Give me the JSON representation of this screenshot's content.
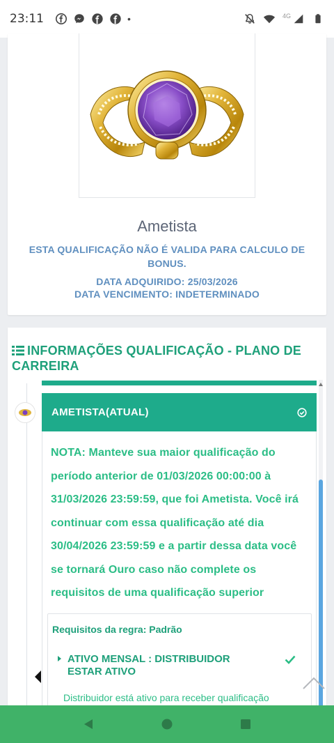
{
  "status_bar": {
    "time": "23:11",
    "notification_icons": [
      "facebook-icon",
      "messenger-icon",
      "facebook-icon",
      "facebook-icon"
    ],
    "dot": "•",
    "network_label": "4G",
    "right_icons": [
      "bell-muted-icon",
      "wifi-icon",
      "signal-icon",
      "battery-icon"
    ]
  },
  "qualification": {
    "name": "Ametista",
    "warning": "ESTA QUALIFICAÇÃO NÃO É VALIDA PARA CALCULO DE BONUS.",
    "acquired": "DATA ADQUIRIDO: 25/03/2026",
    "expiry": "DATA VENCIMENTO: INDETERMINADO"
  },
  "career": {
    "title": "INFORMAÇÕES QUALIFICAÇÃO - PLANO DE CARREIRA",
    "current_level_label": "AMETISTA(ATUAL)",
    "note": "NOTA: Manteve sua maior qualificação do período anterior de 01/03/2026 00:00:00 à 31/03/2026 23:59:59, que foi Ametista. Você irá continuar com essa qualificação até dia 30/04/2026 23:59:59 e a partir dessa data você se tornará Ouro caso não complete os requisitos de uma qualificação superior",
    "requirements_title": "Requisitos da regra: Padrão",
    "requirement_item": "ATIVO MENSAL : DISTRIBUIDOR ESTAR ATIVO",
    "requirement_desc": "Distribuidor está ativo para receber qualificação"
  },
  "colors": {
    "teal": "#1eab8b",
    "green_text": "#2bbd86",
    "blue_text": "#5f8fbf",
    "nav_green": "#40b268"
  },
  "nav": [
    "back-icon",
    "home-icon",
    "recents-icon"
  ]
}
